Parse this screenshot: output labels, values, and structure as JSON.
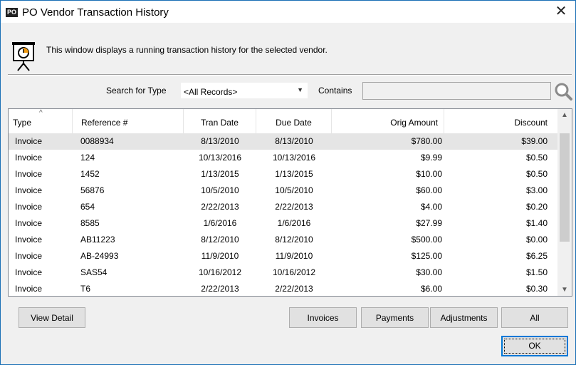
{
  "window": {
    "title": "PO Vendor Transaction History",
    "app_icon_text": "PO",
    "close_glyph": "✕"
  },
  "info": {
    "text": "This window displays a running transaction history for the selected vendor.",
    "icon": "presentation-clock-icon"
  },
  "search": {
    "type_label": "Search for Type",
    "type_value": "<All Records>",
    "contains_label": "Contains",
    "contains_value": "",
    "search_icon": "magnifier-icon"
  },
  "table": {
    "columns": [
      "Type",
      "Reference #",
      "Tran Date",
      "Due Date",
      "Orig Amount",
      "Discount"
    ],
    "selected_row": 0,
    "rows": [
      {
        "type": "Invoice",
        "ref": "0088934",
        "tran": "8/13/2010",
        "due": "8/13/2010",
        "orig": "$780.00",
        "disc": "$39.00"
      },
      {
        "type": "Invoice",
        "ref": "124",
        "tran": "10/13/2016",
        "due": "10/13/2016",
        "orig": "$9.99",
        "disc": "$0.50"
      },
      {
        "type": "Invoice",
        "ref": "1452",
        "tran": "1/13/2015",
        "due": "1/13/2015",
        "orig": "$10.00",
        "disc": "$0.50"
      },
      {
        "type": "Invoice",
        "ref": "56876",
        "tran": "10/5/2010",
        "due": "10/5/2010",
        "orig": "$60.00",
        "disc": "$3.00"
      },
      {
        "type": "Invoice",
        "ref": "654",
        "tran": "2/22/2013",
        "due": "2/22/2013",
        "orig": "$4.00",
        "disc": "$0.20"
      },
      {
        "type": "Invoice",
        "ref": "8585",
        "tran": "1/6/2016",
        "due": "1/6/2016",
        "orig": "$27.99",
        "disc": "$1.40"
      },
      {
        "type": "Invoice",
        "ref": "AB11223",
        "tran": "8/12/2010",
        "due": "8/12/2010",
        "orig": "$500.00",
        "disc": "$0.00"
      },
      {
        "type": "Invoice",
        "ref": "AB-24993",
        "tran": "11/9/2010",
        "due": "11/9/2010",
        "orig": "$125.00",
        "disc": "$6.25"
      },
      {
        "type": "Invoice",
        "ref": "SAS54",
        "tran": "10/16/2012",
        "due": "10/16/2012",
        "orig": "$30.00",
        "disc": "$1.50"
      },
      {
        "type": "Invoice",
        "ref": "T6",
        "tran": "2/22/2013",
        "due": "2/22/2013",
        "orig": "$6.00",
        "disc": "$0.30"
      }
    ]
  },
  "buttons": {
    "view_detail": "View Detail",
    "invoices": "Invoices",
    "payments": "Payments",
    "adjustments": "Adjustments",
    "all": "All",
    "ok": "OK"
  },
  "colors": {
    "window_border": "#1a6fb5",
    "selected_row": "#e5e5e5",
    "default_button_border": "#0078d7"
  }
}
